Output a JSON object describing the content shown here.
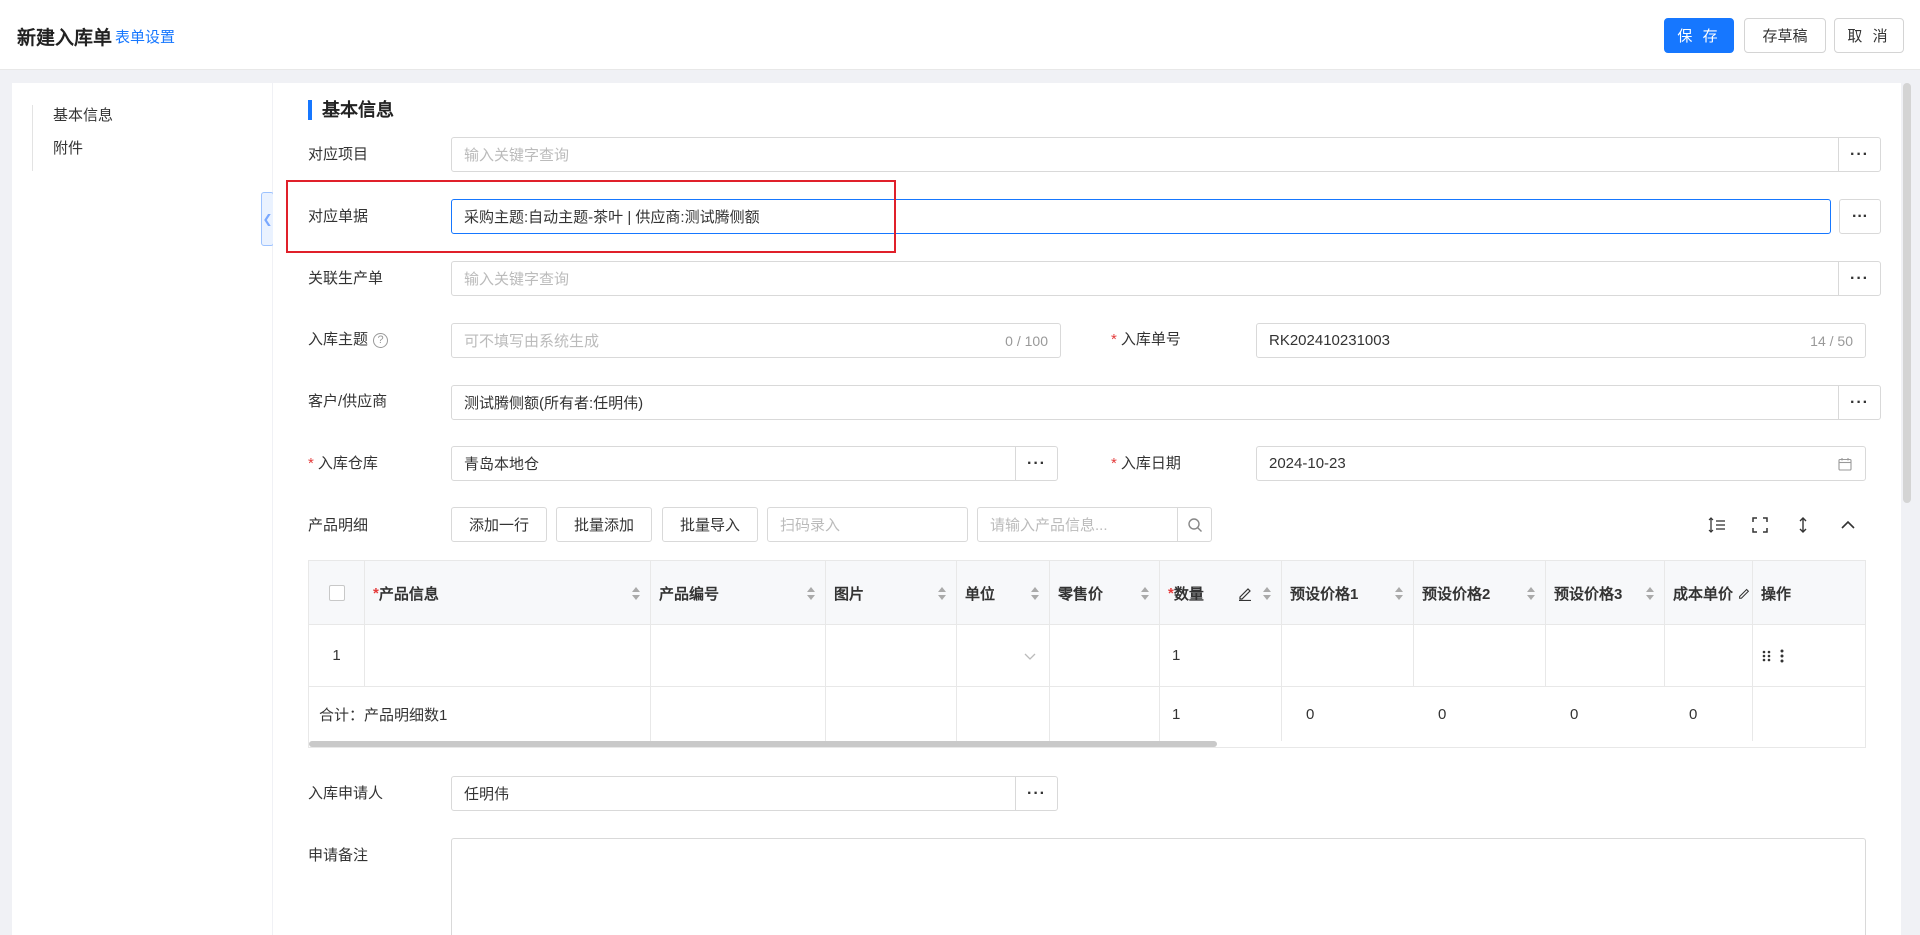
{
  "header": {
    "title": "新建入库单",
    "form_settings": "表单设置",
    "save": "保 存",
    "draft": "存草稿",
    "cancel": "取 消"
  },
  "left_nav": [
    "基本信息",
    "附件"
  ],
  "section_title": "基本信息",
  "form": {
    "project": {
      "label": "对应项目",
      "placeholder": "输入关键字查询"
    },
    "document": {
      "label": "对应单据",
      "value": "采购主题:自动主题-茶叶 | 供应商:测试腾侧额"
    },
    "production": {
      "label": "关联生产单",
      "placeholder": "输入关键字查询"
    },
    "subject": {
      "label": "入库主题",
      "help": "?",
      "placeholder": "可不填写由系统生成",
      "count": "0 / 100"
    },
    "order_no": {
      "label": "入库单号",
      "value": "RK202410231003",
      "count": "14 / 50"
    },
    "customer": {
      "label": "客户/供应商",
      "value": "测试腾侧额(所有者:任明伟)"
    },
    "warehouse": {
      "label": "入库仓库",
      "value": "青岛本地仓"
    },
    "date": {
      "label": "入库日期",
      "value": "2024-10-23"
    },
    "products": {
      "label": "产品明细",
      "add_row": "添加一行",
      "batch_add": "批量添加",
      "batch_import": "批量导入",
      "scan_placeholder": "扫码录入",
      "search_placeholder": "请输入产品信息..."
    },
    "applicant": {
      "label": "入库申请人",
      "value": "任明伟"
    },
    "remarks": {
      "label": "申请备注"
    }
  },
  "required_mark": "*",
  "dots": "···",
  "table": {
    "headers": {
      "product_info": "产品信息",
      "product_code": "产品编号",
      "image": "图片",
      "unit": "单位",
      "retail_price": "零售价",
      "quantity": "数量",
      "preset1": "预设价格1",
      "preset2": "预设价格2",
      "preset3": "预设价格3",
      "cost": "成本单价",
      "ops": "操作"
    },
    "row1": {
      "index": "1",
      "quantity": "1"
    },
    "total": {
      "label": "合计：产品明细数1",
      "quantity": "1",
      "preset1": "0",
      "preset2": "0",
      "preset3": "0",
      "cost": "0"
    }
  },
  "colors": {
    "primary": "#1677ff",
    "required": "#e43b3b",
    "highlight": "#e0202a"
  }
}
